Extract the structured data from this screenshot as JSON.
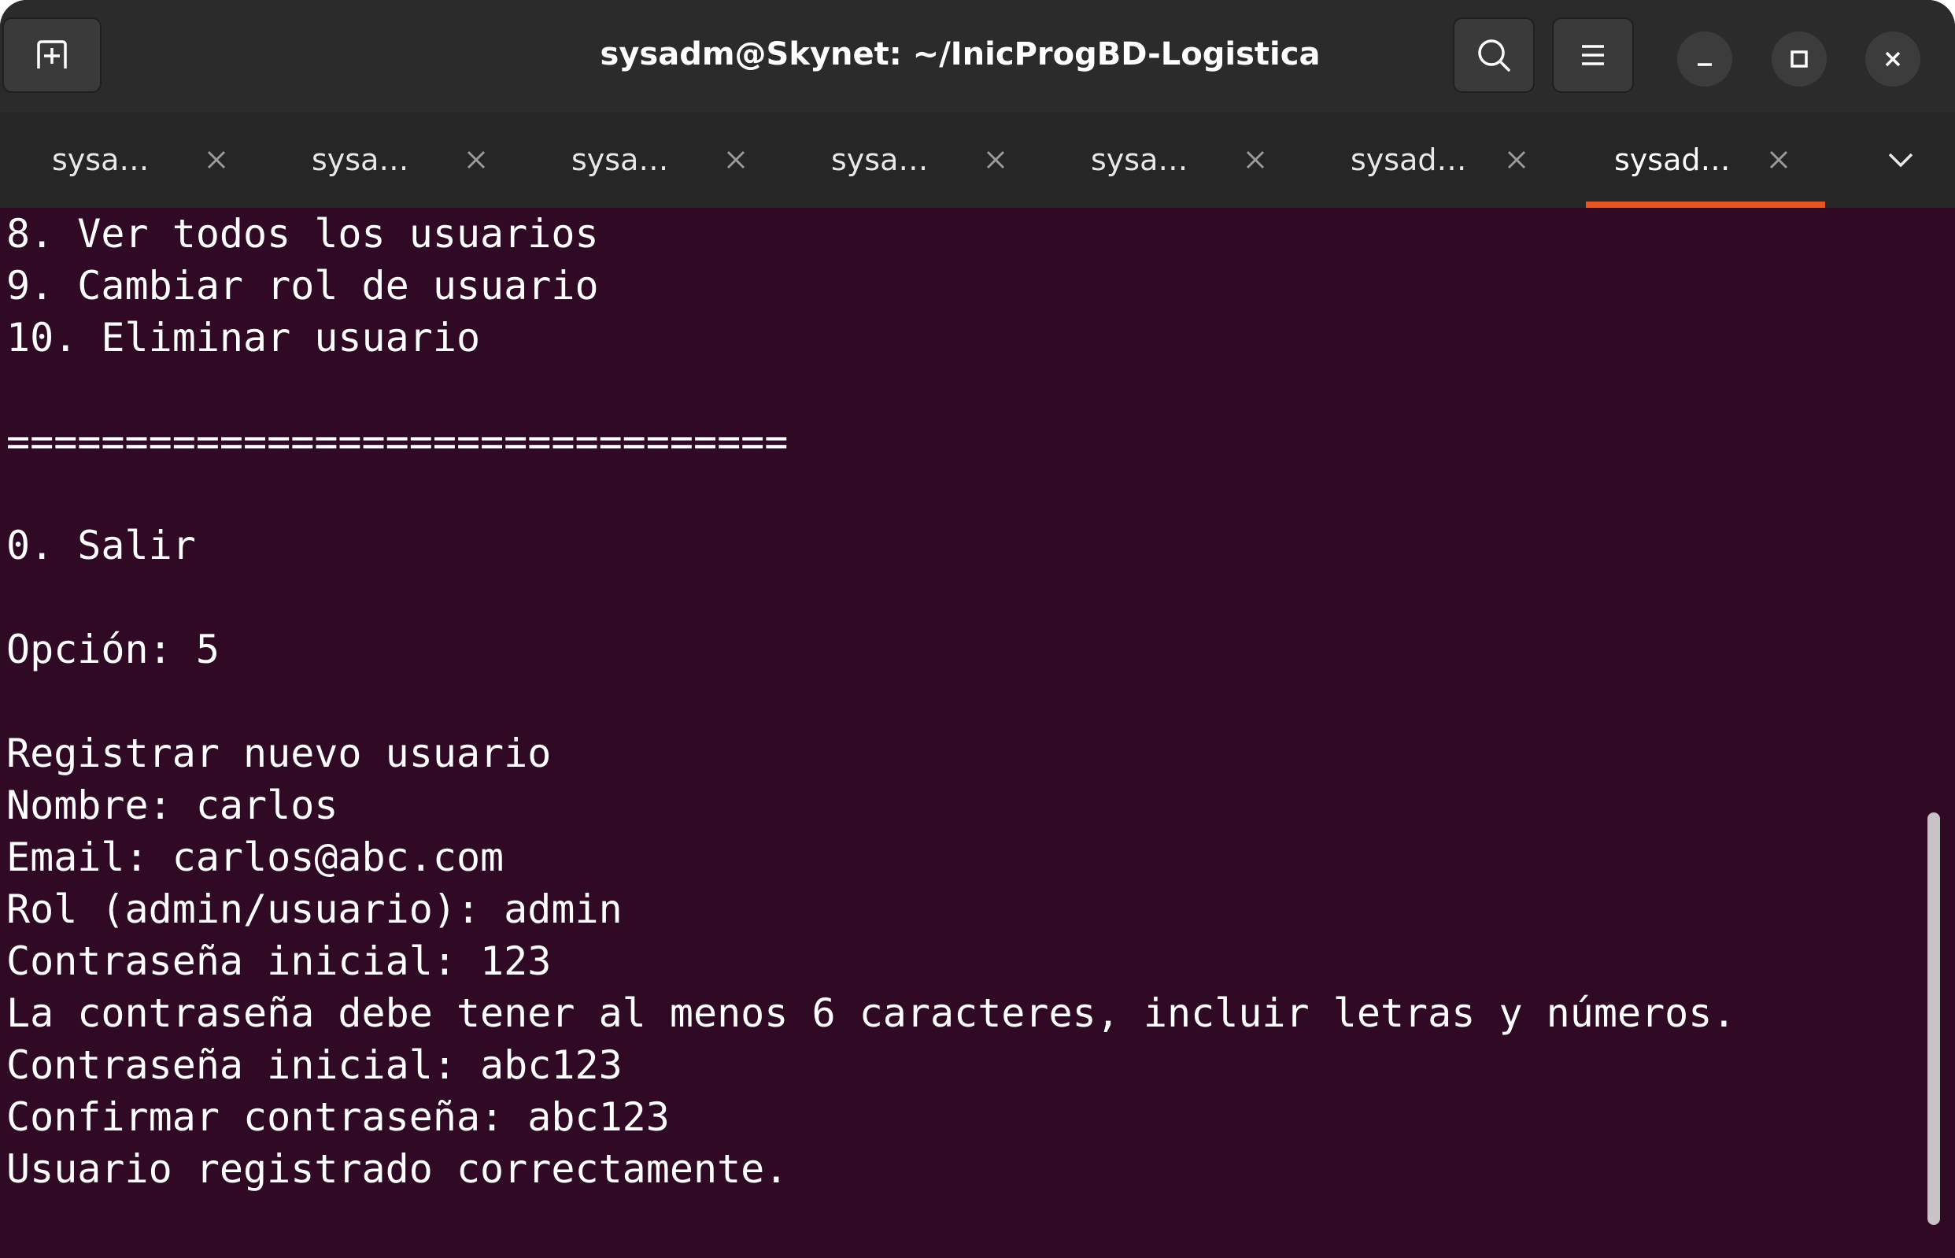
{
  "window": {
    "title": "sysadm@Skynet: ~/InicProgBD-Logistica"
  },
  "header": {
    "new_tab_icon": "new-tab-icon",
    "search_icon": "search-icon",
    "menu_icon": "hamburger-menu-icon",
    "minimize_icon": "minimize-icon",
    "maximize_icon": "maximize-icon",
    "close_icon": "close-icon"
  },
  "tabs": [
    {
      "label": "sysa…"
    },
    {
      "label": "sysa…"
    },
    {
      "label": "sysa…"
    },
    {
      "label": "sysa…"
    },
    {
      "label": "sysa…"
    },
    {
      "label": "sysad…"
    },
    {
      "label": "sysad…",
      "active": true
    }
  ],
  "tabs_menu_icon": "chevron-down-icon",
  "terminal": {
    "lines": [
      "8. Ver todos los usuarios",
      "9. Cambiar rol de usuario",
      "10. Eliminar usuario",
      "",
      "=================================",
      "",
      "0. Salir",
      "",
      "Opción: 5",
      "",
      "Registrar nuevo usuario",
      "Nombre: carlos",
      "Email: carlos@abc.com",
      "Rol (admin/usuario): admin",
      "Contraseña inicial: 123",
      "La contraseña debe tener al menos 6 caracteres, incluir letras y números.",
      "Contraseña inicial: abc123",
      "Confirmar contraseña: abc123",
      "Usuario registrado correctamente."
    ]
  },
  "colors": {
    "terminal_bg": "#300a24",
    "terminal_fg": "#ffffff",
    "headerbar_bg": "#2b2b2b",
    "tabbar_bg": "#262626",
    "active_tab_indicator": "#e95420"
  }
}
